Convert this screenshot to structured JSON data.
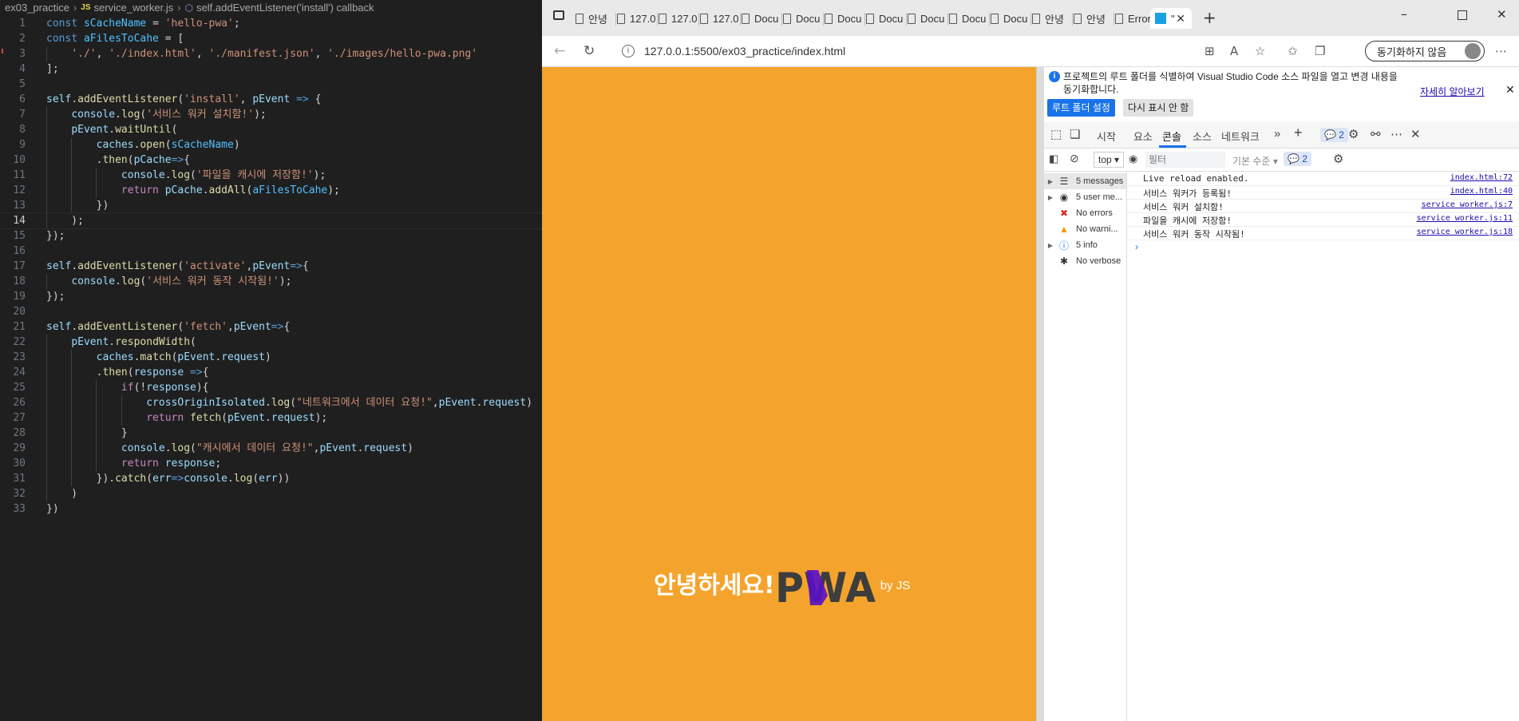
{
  "editor": {
    "breadcrumb": [
      "ex03_practice",
      "service_worker.js",
      "self.addEventListener('install') callback"
    ],
    "js_badge": "JS",
    "lines": [
      {
        "n": "1",
        "html": "<span class=\"k\">const</span> <span class=\"c\">sCacheName</span> = <span class=\"s\">'hello-pwa'</span>;"
      },
      {
        "n": "2",
        "html": "<span class=\"k\">const</span> <span class=\"c\">aFilesToCahe</span> = ["
      },
      {
        "n": "3",
        "html": "    <span class=\"s\">'./'</span>, <span class=\"s\">'./index.html'</span>, <span class=\"s\">'./manifest.json'</span>, <span class=\"s\">'./images/hello-pwa.png'</span>"
      },
      {
        "n": "4",
        "html": "];"
      },
      {
        "n": "5",
        "html": ""
      },
      {
        "n": "6",
        "html": "<span class=\"v\">self</span>.<span class=\"f\">addEventListener</span>(<span class=\"s\">'install'</span>, <span class=\"v\">pEvent</span> <span class=\"k\">=&gt;</span> {"
      },
      {
        "n": "7",
        "html": "    <span class=\"v\">console</span>.<span class=\"f\">log</span>(<span class=\"s\">'서비스 워커 설치함!'</span>);"
      },
      {
        "n": "8",
        "html": "    <span class=\"v\">pEvent</span>.<span class=\"f\">waitUntil</span>("
      },
      {
        "n": "9",
        "html": "        <span class=\"v\">caches</span>.<span class=\"f\">open</span>(<span class=\"c\">sCacheName</span>)"
      },
      {
        "n": "10",
        "html": "        .<span class=\"f\">then</span>(<span class=\"v\">pCache</span><span class=\"k\">=&gt;</span>{"
      },
      {
        "n": "11",
        "html": "            <span class=\"v\">console</span>.<span class=\"f\">log</span>(<span class=\"s\">'파일을 캐시에 저장함!'</span>);"
      },
      {
        "n": "12",
        "html": "            <span class=\"kw\">return</span> <span class=\"v\">pCache</span>.<span class=\"f\">addAll</span>(<span class=\"c\">aFilesToCahe</span>);"
      },
      {
        "n": "13",
        "html": "        })"
      },
      {
        "n": "14",
        "html": "    );"
      },
      {
        "n": "15",
        "html": "});"
      },
      {
        "n": "16",
        "html": ""
      },
      {
        "n": "17",
        "html": "<span class=\"v\">self</span>.<span class=\"f\">addEventListener</span>(<span class=\"s\">'activate'</span>,<span class=\"v\">pEvent</span><span class=\"k\">=&gt;</span>{"
      },
      {
        "n": "18",
        "html": "    <span class=\"v\">console</span>.<span class=\"f\">log</span>(<span class=\"s\">'서비스 워커 동작 시작됨!'</span>);"
      },
      {
        "n": "19",
        "html": "});"
      },
      {
        "n": "20",
        "html": ""
      },
      {
        "n": "21",
        "html": "<span class=\"v\">self</span>.<span class=\"f\">addEventListener</span>(<span class=\"s\">'fetch'</span>,<span class=\"v\">pEvent</span><span class=\"k\">=&gt;</span>{"
      },
      {
        "n": "22",
        "html": "    <span class=\"v\">pEvent</span>.<span class=\"f\">respondWidth</span>("
      },
      {
        "n": "23",
        "html": "        <span class=\"v\">caches</span>.<span class=\"f\">match</span>(<span class=\"v\">pEvent</span>.<span class=\"v\">request</span>)"
      },
      {
        "n": "24",
        "html": "        .<span class=\"f\">then</span>(<span class=\"v\">response</span> <span class=\"k\">=&gt;</span>{"
      },
      {
        "n": "25",
        "html": "            <span class=\"kw\">if</span>(!<span class=\"v\">response</span>){"
      },
      {
        "n": "26",
        "html": "                <span class=\"v\">crossOriginIsolated</span>.<span class=\"f\">log</span>(<span class=\"s\">\"네트워크에서 데이터 요청!\"</span>,<span class=\"v\">pEvent</span>.<span class=\"v\">request</span>)"
      },
      {
        "n": "27",
        "html": "                <span class=\"kw\">return</span> <span class=\"f\">fetch</span>(<span class=\"v\">pEvent</span>.<span class=\"v\">request</span>);"
      },
      {
        "n": "28",
        "html": "            }"
      },
      {
        "n": "29",
        "html": "            <span class=\"v\">console</span>.<span class=\"f\">log</span>(<span class=\"s\">\"캐시에서 데이터 요청!\"</span>,<span class=\"v\">pEvent</span>.<span class=\"v\">request</span>)"
      },
      {
        "n": "30",
        "html": "            <span class=\"kw\">return</span> <span class=\"v\">response</span>;"
      },
      {
        "n": "31",
        "html": "        }).<span class=\"f\">catch</span>(<span class=\"v\">err</span><span class=\"k\">=&gt;</span><span class=\"v\">console</span>.<span class=\"f\">log</span>(<span class=\"v\">err</span>))"
      },
      {
        "n": "32",
        "html": "    )"
      },
      {
        "n": "33",
        "html": "})"
      }
    ],
    "active_line": "14"
  },
  "browser": {
    "tabs": [
      {
        "label": "안녕"
      },
      {
        "label": "127.0"
      },
      {
        "label": "127.0"
      },
      {
        "label": "127.0"
      },
      {
        "label": "Docu"
      },
      {
        "label": "Docu"
      },
      {
        "label": "Docu"
      },
      {
        "label": "Docu"
      },
      {
        "label": "Docu"
      },
      {
        "label": "Docu"
      },
      {
        "label": "Docu"
      },
      {
        "label": "안녕"
      },
      {
        "label": "안녕"
      },
      {
        "label": "Error"
      }
    ],
    "active_tab": {
      "label": "\""
    },
    "url": "127.0.0.1:5500/ex03_practice/index.html",
    "sync_label": "동기화하지 않음",
    "accent_color": "#f4a42d"
  },
  "page": {
    "greeting": "안녕하세요!",
    "logo_text": "PWA",
    "byline": "by JS"
  },
  "devtools": {
    "info_message": "프로젝트의 루트 폴더를 식별하여 Visual Studio Code 소스 파일을 열고 변경 내용을 동기화합니다.",
    "learn_more": "자세히 알아보기",
    "set_root_button": "루트 폴더 설정",
    "dont_show_button": "다시 표시 안 함",
    "tabs": [
      "시작",
      "요소",
      "콘솔",
      "소스",
      "네트워크"
    ],
    "active_tab": "콘솔",
    "issues_count": "2",
    "context": "top",
    "filter_placeholder": "필터",
    "levels_label": "기본 수준",
    "issues_badge": "2",
    "sidebar": [
      {
        "label": "5 messages",
        "icon": "list-icon",
        "expand": true
      },
      {
        "label": "5 user me...",
        "icon": "user-icon",
        "expand": true
      },
      {
        "label": "No errors",
        "icon": "error-icon",
        "expand": false
      },
      {
        "label": "No warni...",
        "icon": "warning-icon",
        "expand": false
      },
      {
        "label": "5 info",
        "icon": "info-icon",
        "expand": true
      },
      {
        "label": "No verbose",
        "icon": "bug-icon",
        "expand": false
      }
    ],
    "logs": [
      {
        "message": "Live reload enabled.",
        "source": "index.html:72"
      },
      {
        "message": "서비스 워커가 등록됨!",
        "source": "index.html:40"
      },
      {
        "message": "서비스 워커 설치함!",
        "source": "service worker.js:7"
      },
      {
        "message": "파일을 캐시에 저장함!",
        "source": "service worker.js:11"
      },
      {
        "message": "서비스 워커 동작 시작됨!",
        "source": "service worker.js:18"
      }
    ],
    "prompt": "›"
  }
}
